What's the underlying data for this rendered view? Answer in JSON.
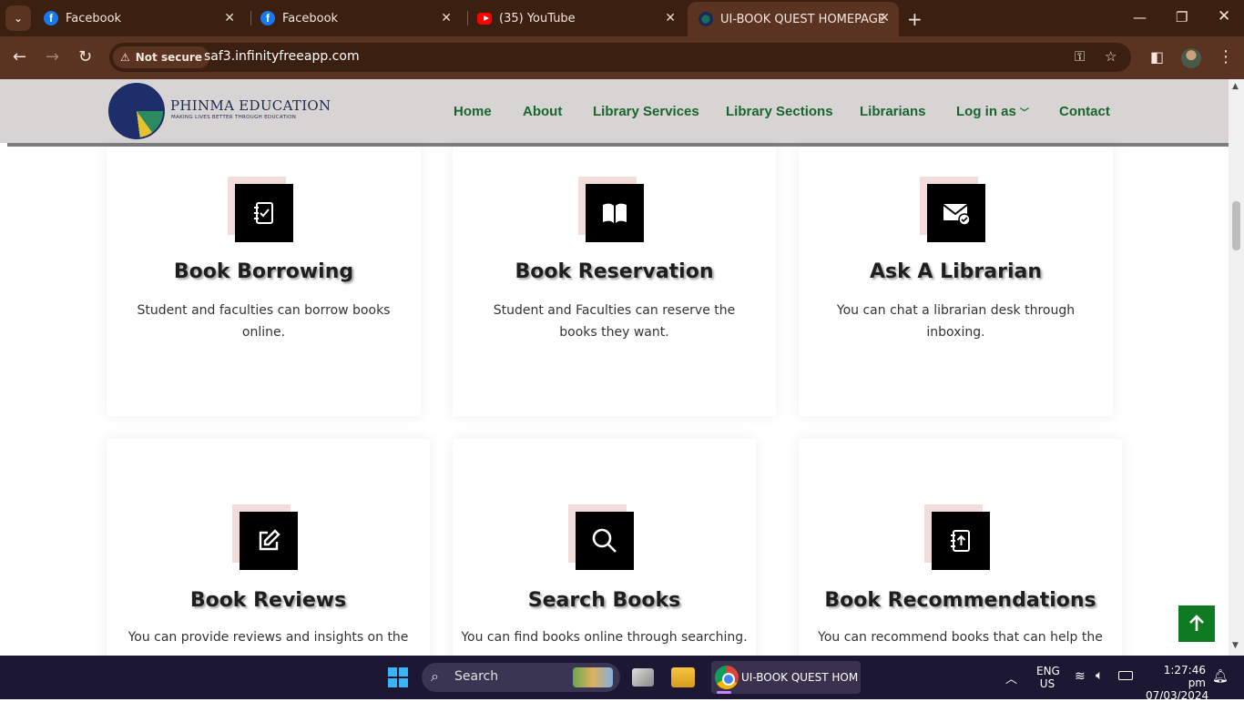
{
  "browser": {
    "tabs": [
      {
        "title": "Facebook",
        "icon": "facebook-icon"
      },
      {
        "title": "Facebook",
        "icon": "facebook-icon"
      },
      {
        "title": "(35) YouTube",
        "icon": "youtube-icon"
      },
      {
        "title": "UI-BOOK QUEST HOMEPAGE",
        "icon": "phinma-icon",
        "active": true
      }
    ],
    "security_label": "Not secure",
    "url": "saf3.infinityfreeapp.com"
  },
  "site": {
    "logo_title": "PHINMA EDUCATION",
    "logo_subtitle": "MAKING LIVES BETTER THROUGH EDUCATION",
    "nav": [
      "Home",
      "About",
      "Library Services",
      "Library Sections",
      "Librarians",
      "Log in as",
      "Contact"
    ],
    "accent_color": "#0e7a21",
    "nav_color": "#17652f"
  },
  "services": [
    {
      "title": "Book Borrowing",
      "text": "Student and faculties can borrow books online.",
      "icon": "checklist-notebook-icon"
    },
    {
      "title": "Book Reservation",
      "text": "Student and Faculties can reserve the books they want.",
      "icon": "open-book-icon"
    },
    {
      "title": "Ask A Librarian",
      "text": "You can chat a librarian desk through inboxing.",
      "icon": "mail-check-icon"
    },
    {
      "title": "Book Reviews",
      "text": "You can provide reviews and insights on the",
      "icon": "edit-icon"
    },
    {
      "title": "Search Books",
      "text": "You can find books online through searching.",
      "icon": "search-icon"
    },
    {
      "title": "Book Recommendations",
      "text": "You can recommend books that can help the",
      "icon": "upload-notebook-icon"
    }
  ],
  "taskbar": {
    "search_label": "Search",
    "active_app": "UI-BOOK QUEST HOMEPAGE",
    "lang": "ENG",
    "region": "US",
    "time": "1:27:46 pm",
    "date": "07/03/2024"
  }
}
